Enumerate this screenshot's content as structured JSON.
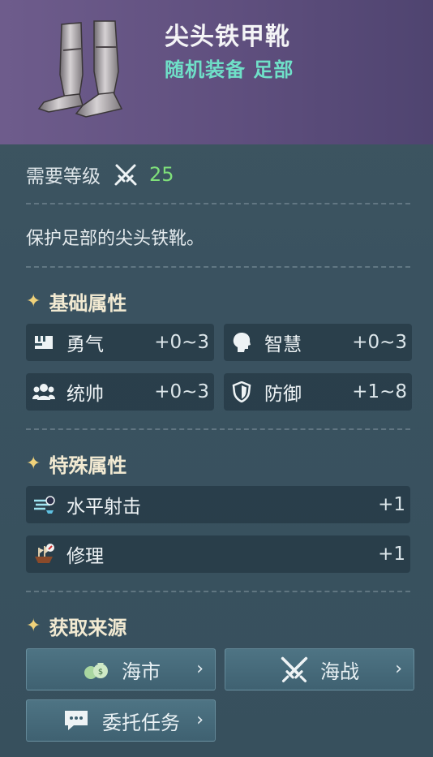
{
  "item": {
    "name": "尖头铁甲靴",
    "subtitle": "随机装备 足部",
    "image": "iron-boots"
  },
  "level": {
    "label": "需要等级",
    "icon": "crossed-swords-icon",
    "value": "25"
  },
  "description": "保护足部的尖头铁靴。",
  "basic": {
    "title": "基础属性",
    "stats": [
      {
        "icon": "courage-icon",
        "name": "勇气",
        "value": "+0~3"
      },
      {
        "icon": "wisdom-icon",
        "name": "智慧",
        "value": "+0~3"
      },
      {
        "icon": "command-icon",
        "name": "统帅",
        "value": "+0~3"
      },
      {
        "icon": "defense-icon",
        "name": "防御",
        "value": "+1~8"
      }
    ]
  },
  "special": {
    "title": "特殊属性",
    "stats": [
      {
        "icon": "horizontal-shot-icon",
        "name": "水平射击",
        "value": "+1"
      },
      {
        "icon": "repair-icon",
        "name": "修理",
        "value": "+1"
      }
    ]
  },
  "sources": {
    "title": "获取来源",
    "buttons": [
      {
        "icon": "money-bag-icon",
        "label": "海市"
      },
      {
        "icon": "crossed-swords-icon",
        "label": "海战"
      },
      {
        "icon": "chat-icon",
        "label": "委托任务"
      }
    ]
  },
  "colors": {
    "header": "#6e5c8c",
    "subtitle": "#6fe0c8",
    "level_value": "#7fe07a",
    "accent_star": "#f0d27a"
  }
}
